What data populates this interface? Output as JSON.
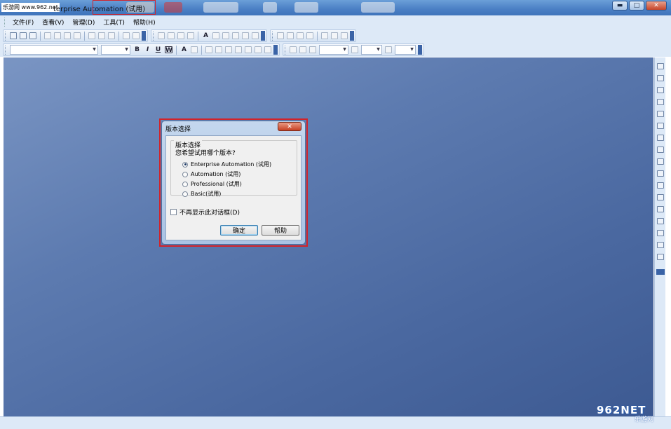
{
  "window": {
    "site_label": "乐游网 www.962.net",
    "title": "terprise Automation (试用)",
    "controls": {
      "minimize": "▬",
      "maximize": "□",
      "close": "✕"
    }
  },
  "menu": {
    "items": [
      "文件(F)",
      "查看(V)",
      "管理(D)",
      "工具(T)",
      "帮助(H)"
    ]
  },
  "format_toolbar": {
    "font_name_value": "",
    "font_size_value": "",
    "bold": "B",
    "italic": "I",
    "underline": "U",
    "word_wrap": "W",
    "font_color": "A"
  },
  "dialog": {
    "title": "版本选择",
    "close_label": "✕",
    "group_label": "版本选择",
    "prompt": "您希望试用哪个版本?",
    "options": [
      {
        "label": "Enterprise Automation (试用)",
        "selected": true
      },
      {
        "label": "Automation (试用)",
        "selected": false
      },
      {
        "label": "Professional (试用)",
        "selected": false
      },
      {
        "label": "Basic(试用)",
        "selected": false
      }
    ],
    "dont_show_label": "不再显示此对话框(D)",
    "dont_show_checked": false,
    "ok_label": "确定",
    "help_label": "帮助"
  },
  "watermark": {
    "top": "962NET",
    "bottom": "乐游网"
  },
  "colors": {
    "workspace": "#5d7bb0",
    "highlight_border": "#d2232a",
    "title_bar": "#4a7fc4"
  }
}
